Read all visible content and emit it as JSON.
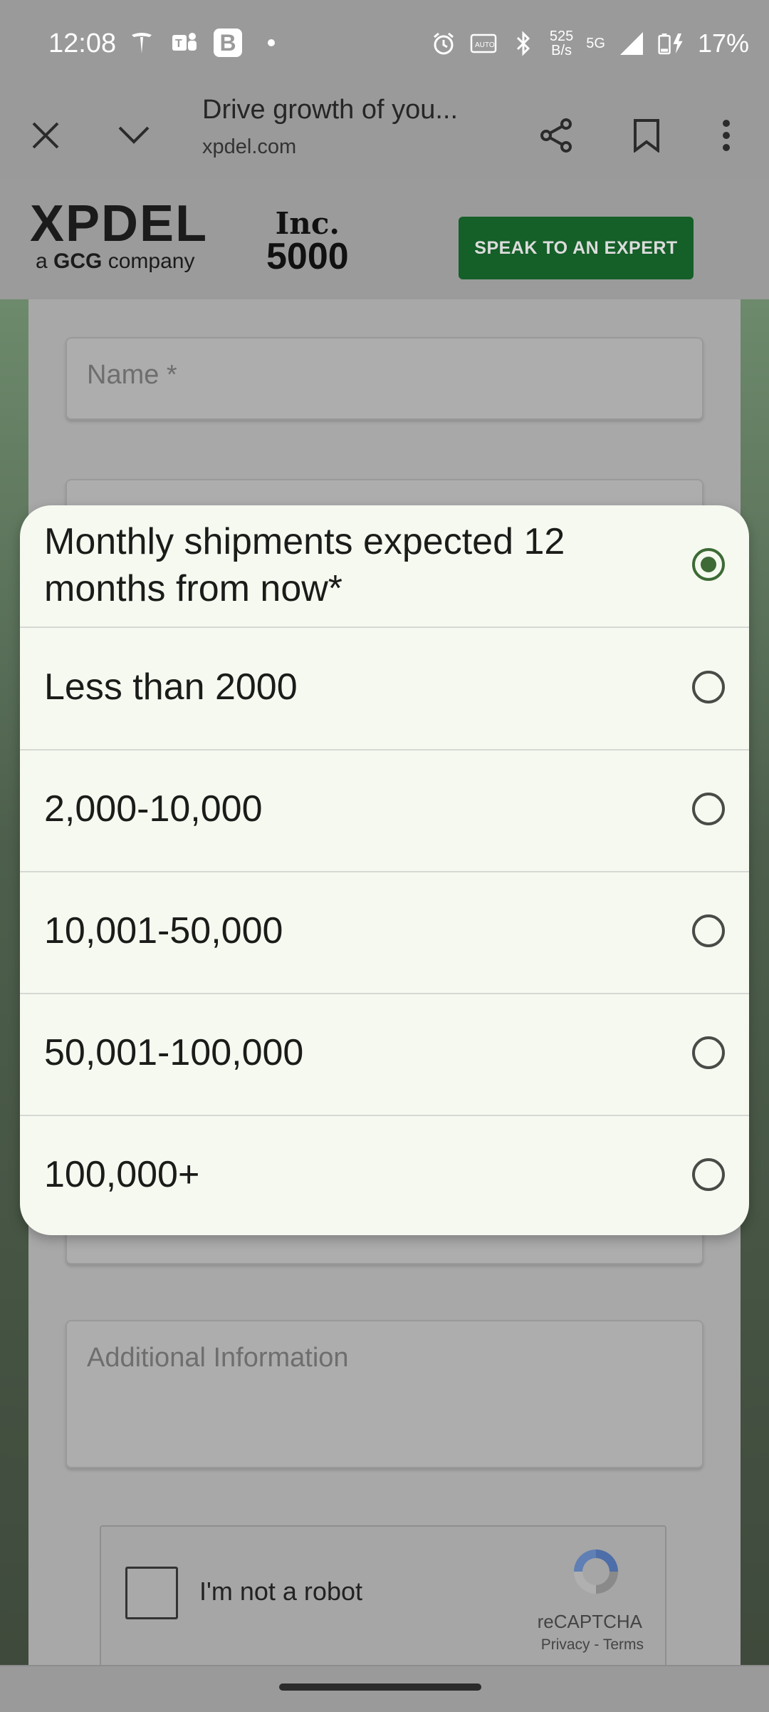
{
  "status_bar": {
    "time": "12:08",
    "net_speed_value": "525",
    "net_speed_unit": "B/s",
    "network": "5G",
    "battery": "17%"
  },
  "browser": {
    "page_title": "Drive growth of you...",
    "url": "xpdel.com"
  },
  "header": {
    "logo_text": "XPDEL",
    "logo_tagline_prefix": "a",
    "logo_tagline_bold": "GCG",
    "logo_tagline_suffix": "company",
    "inc_top": "Inc.",
    "inc_number": "5000",
    "cta_label": "SPEAK TO AN EXPERT"
  },
  "form": {
    "name_placeholder": "Name *",
    "additional_info_placeholder": "Additional Information",
    "recaptcha_label": "I'm not a robot",
    "recaptcha_brand": "reCAPTCHA",
    "recaptcha_links": "Privacy - Terms"
  },
  "dialog": {
    "options": [
      {
        "label": "Monthly shipments expected 12 months from now*",
        "selected": true
      },
      {
        "label": "Less than 2000",
        "selected": false
      },
      {
        "label": "2,000-10,000",
        "selected": false
      },
      {
        "label": "10,001-50,000",
        "selected": false
      },
      {
        "label": "50,001-100,000",
        "selected": false
      },
      {
        "label": "100,000+",
        "selected": false
      }
    ]
  },
  "colors": {
    "accent_green": "#3d6a35",
    "cta_green": "#155f28",
    "dialog_bg": "#f5f9f0"
  }
}
